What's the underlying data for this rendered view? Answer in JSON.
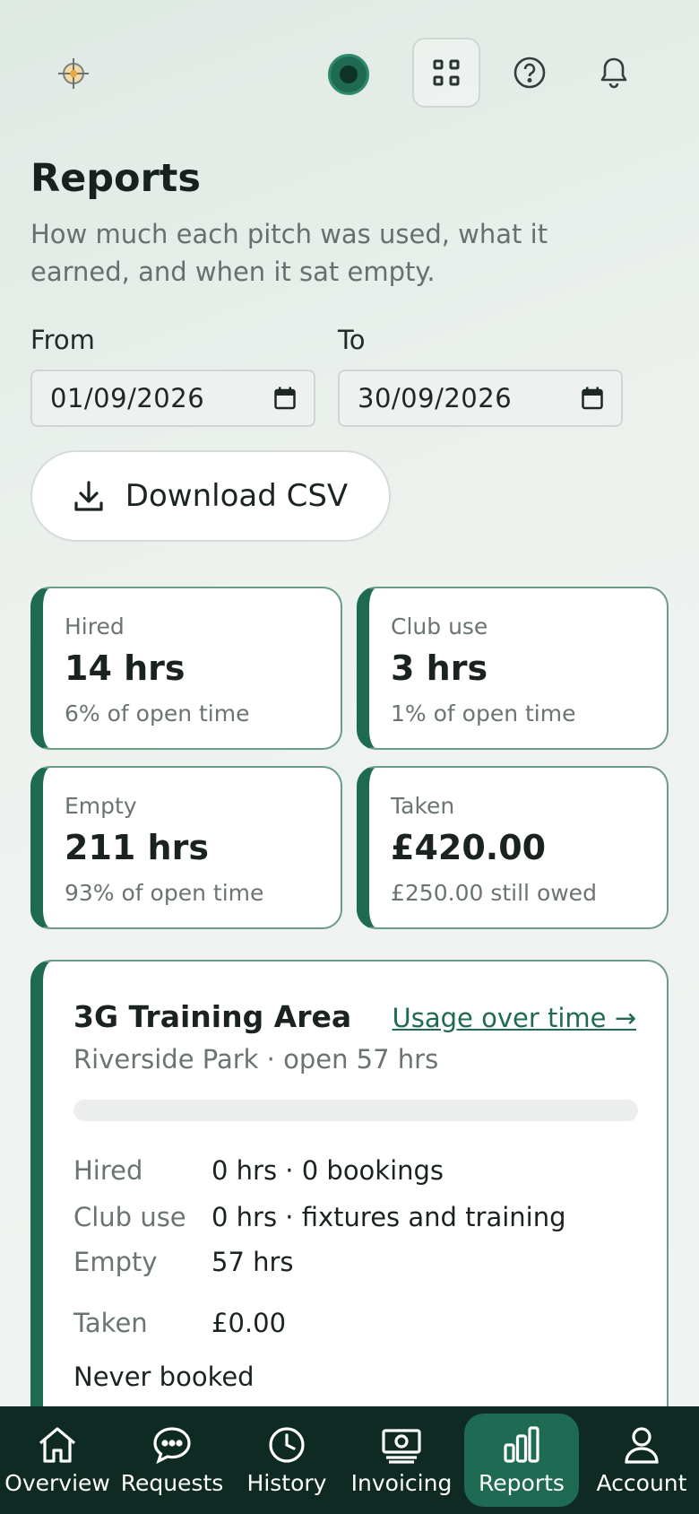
{
  "header": {
    "logo": "crosshair-logo-icon",
    "status": "status-dot",
    "apps_icon": "grid-icon",
    "help_icon": "help-icon",
    "bell_icon": "bell-icon"
  },
  "page": {
    "title": "Reports",
    "subtitle": "How much each pitch was used, what it earned, and when it sat empty."
  },
  "filters": {
    "from_label": "From",
    "from_value": "01/09/2026",
    "to_label": "To",
    "to_value": "30/09/2026"
  },
  "download": {
    "label": "Download CSV",
    "icon": "download-icon"
  },
  "stats": [
    {
      "label": "Hired",
      "value": "14 hrs",
      "sub": "6% of open time"
    },
    {
      "label": "Club use",
      "value": "3 hrs",
      "sub": "1% of open time"
    },
    {
      "label": "Empty",
      "value": "211 hrs",
      "sub": "93% of open time"
    },
    {
      "label": "Taken",
      "value": "£420.00",
      "sub": "£250.00 still owed"
    }
  ],
  "pitch": {
    "name": "3G Training Area",
    "link": "Usage over time →",
    "location": "Riverside Park · open 57 hrs",
    "usage_fraction": 0,
    "rows": [
      {
        "label": "Hired",
        "value": "0 hrs · 0 bookings"
      },
      {
        "label": "Club use",
        "value": "0 hrs · fixtures and training"
      },
      {
        "label": "Empty",
        "value": "57 hrs"
      },
      {
        "label": "Taken",
        "value": "£0.00"
      }
    ],
    "note": "Never booked"
  },
  "nav": [
    {
      "label": "Overview",
      "icon": "home-icon",
      "active": false
    },
    {
      "label": "Requests",
      "icon": "chat-icon",
      "active": false
    },
    {
      "label": "History",
      "icon": "clock-icon",
      "active": false
    },
    {
      "label": "Invoicing",
      "icon": "cash-icon",
      "active": false
    },
    {
      "label": "Reports",
      "icon": "bar-chart-icon",
      "active": true
    },
    {
      "label": "Account",
      "icon": "user-icon",
      "active": false
    }
  ],
  "colors": {
    "accent": "#1f6a52",
    "nav_bg": "#0e2a22"
  }
}
